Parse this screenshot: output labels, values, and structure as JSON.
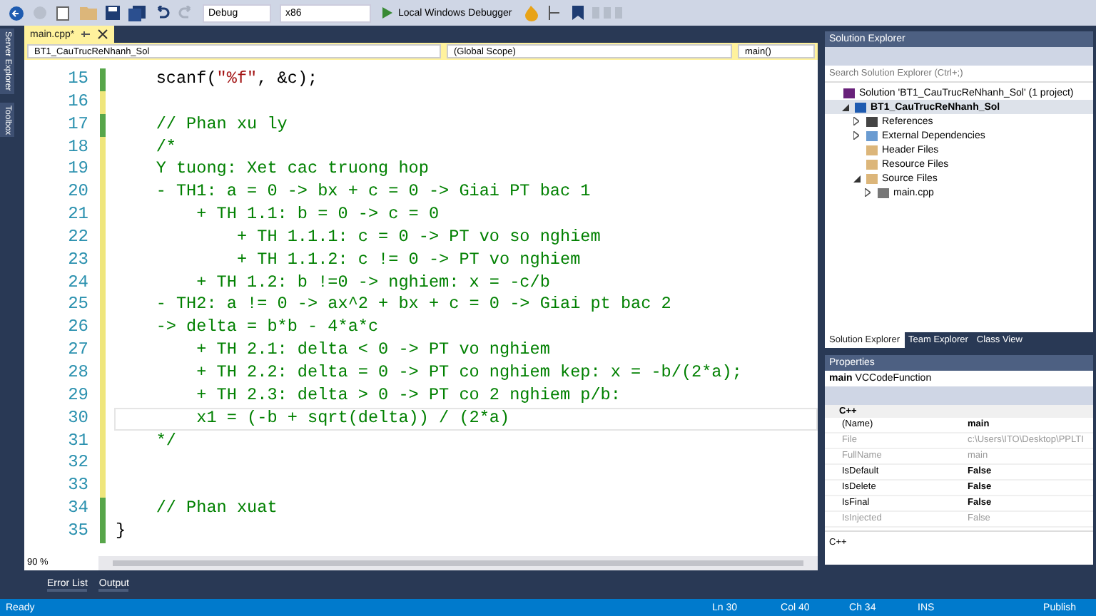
{
  "toolbar": {
    "configuration": "Debug",
    "platform": "x86",
    "debugger": "Local Windows Debugger"
  },
  "side_tabs": [
    "Server Explorer",
    "Toolbox"
  ],
  "document_tabs": [
    {
      "label": "main.cpp*",
      "selected": true
    }
  ],
  "nav_bar": {
    "project": "BT1_CauTrucReNhanh_Sol",
    "scope": "(Global Scope)",
    "member": "main()"
  },
  "editor": {
    "lines": [
      {
        "number": "15",
        "saved": true,
        "selected": false,
        "segments": [
          {
            "kind": "plain",
            "text": "    scanf("
          },
          {
            "kind": "string",
            "text": "\"%f\""
          },
          {
            "kind": "plain",
            "text": ", &c);"
          }
        ]
      },
      {
        "number": "16",
        "saved": false,
        "selected": false
      },
      {
        "number": "17",
        "saved": true,
        "selected": false,
        "segments": [
          {
            "kind": "comment",
            "text": "    // Phan xu ly"
          }
        ]
      },
      {
        "number": "18",
        "saved": false,
        "selected": false,
        "segments": [
          {
            "kind": "comment",
            "text": "    /*"
          }
        ]
      },
      {
        "number": "19",
        "saved": false,
        "selected": false,
        "segments": [
          {
            "kind": "comment",
            "text": "    Y tuong: Xet cac truong hop"
          }
        ]
      },
      {
        "number": "20",
        "saved": false,
        "selected": false,
        "segments": [
          {
            "kind": "comment",
            "text": "    - TH1: a = 0 -> bx + c = 0 -> Giai PT bac 1"
          }
        ]
      },
      {
        "number": "21",
        "saved": false,
        "selected": false,
        "segments": [
          {
            "kind": "comment",
            "text": "        + TH 1.1: b = 0 -> c = 0"
          }
        ]
      },
      {
        "number": "22",
        "saved": false,
        "selected": false,
        "segments": [
          {
            "kind": "comment",
            "text": "            + TH 1.1.1: c = 0 -> PT vo so nghiem"
          }
        ]
      },
      {
        "number": "23",
        "saved": false,
        "selected": false,
        "segments": [
          {
            "kind": "comment",
            "text": "            + TH 1.1.2: c != 0 -> PT vo nghiem"
          }
        ]
      },
      {
        "number": "24",
        "saved": false,
        "selected": false,
        "segments": [
          {
            "kind": "comment",
            "text": "        + TH 1.2: b !=0 -> nghiem: x = -c/b"
          }
        ]
      },
      {
        "number": "25",
        "saved": false,
        "selected": false,
        "segments": [
          {
            "kind": "comment",
            "text": "    - TH2: a != 0 -> ax^2 + bx + c = 0 -> Giai pt bac 2"
          }
        ]
      },
      {
        "number": "26",
        "saved": false,
        "selected": false,
        "segments": [
          {
            "kind": "comment",
            "text": "    -> delta = b*b - 4*a*c"
          }
        ]
      },
      {
        "number": "27",
        "saved": false,
        "selected": false,
        "segments": [
          {
            "kind": "comment",
            "text": "        + TH 2.1: delta < 0 -> PT vo nghiem"
          }
        ]
      },
      {
        "number": "28",
        "saved": false,
        "selected": false,
        "segments": [
          {
            "kind": "comment",
            "text": "        + TH 2.2: delta = 0 -> PT co nghiem kep: x = -b/(2*a);"
          }
        ]
      },
      {
        "number": "29",
        "saved": false,
        "selected": false,
        "segments": [
          {
            "kind": "comment",
            "text": "        + TH 2.3: delta > 0 -> PT co 2 nghiem p/b:"
          }
        ]
      },
      {
        "number": "30",
        "saved": false,
        "selected": true,
        "segments": [
          {
            "kind": "comment",
            "text": "        x1 = (-b + sqrt(delta)) / (2*a)"
          }
        ]
      },
      {
        "number": "31",
        "saved": false,
        "selected": false,
        "segments": [
          {
            "kind": "comment",
            "text": "    */"
          }
        ]
      },
      {
        "number": "32",
        "saved": false,
        "selected": false
      },
      {
        "number": "33",
        "saved": false,
        "selected": false
      },
      {
        "number": "34",
        "saved": true,
        "selected": false,
        "segments": [
          {
            "kind": "comment",
            "text": "    // Phan xuat"
          }
        ]
      },
      {
        "number": "35",
        "saved": true,
        "selected": false,
        "segments": [
          {
            "kind": "plain",
            "text": "}"
          }
        ]
      }
    ],
    "zoom": "90 %"
  },
  "bottom_tabs": [
    {
      "label": "Error List"
    },
    {
      "label": "Output"
    }
  ],
  "solution_explorer": {
    "title": "Solution Explorer",
    "search": {
      "placeholder": "Search Solution Explorer (Ctrl+;)"
    },
    "tree": [
      {
        "label": "Solution 'BT1_CauTrucReNhanh_Sol' (1 project)",
        "kind": "solution",
        "selected": false,
        "children": [
          {
            "label": "BT1_CauTrucReNhanh_Sol",
            "kind": "project",
            "expanded": true,
            "selected": true,
            "children": [
              {
                "label": "References",
                "kind": "references",
                "expanded": false,
                "selected": false
              },
              {
                "label": "External Dependencies",
                "kind": "dependencies",
                "expanded": false,
                "selected": false
              },
              {
                "label": "Header Files",
                "kind": "folder",
                "selected": false
              },
              {
                "label": "Resource Files",
                "kind": "folder",
                "selected": false
              },
              {
                "label": "Source Files",
                "kind": "folder",
                "expanded": true,
                "selected": false,
                "children": [
                  {
                    "label": "main.cpp",
                    "kind": "file",
                    "expanded": false,
                    "selected": false
                  }
                ]
              }
            ]
          }
        ]
      }
    ],
    "tabs": [
      {
        "label": "Solution Explorer",
        "selected": true
      },
      {
        "label": "Team Explorer",
        "selected": false
      },
      {
        "label": "Class View",
        "selected": false
      }
    ]
  },
  "properties": {
    "title": "Properties",
    "object_name": "main",
    "object_type": "VCCodeFunction",
    "category": "C++",
    "rows": [
      {
        "name": "(Name)",
        "value": "main",
        "bold": true,
        "disabled": false
      },
      {
        "name": "File",
        "value": "c:\\Users\\ITO\\Desktop\\PPLTI",
        "bold": false,
        "disabled": true
      },
      {
        "name": "FullName",
        "value": "main",
        "bold": false,
        "disabled": true
      },
      {
        "name": "IsDefault",
        "value": "False",
        "bold": true,
        "disabled": false
      },
      {
        "name": "IsDelete",
        "value": "False",
        "bold": true,
        "disabled": false
      },
      {
        "name": "IsFinal",
        "value": "False",
        "bold": true,
        "disabled": false
      },
      {
        "name": "IsInjected",
        "value": "False",
        "bold": false,
        "disabled": true
      }
    ],
    "description": "C++"
  },
  "status_bar": {
    "state": "Ready",
    "line": "Ln 30",
    "column": "Col 40",
    "character": "Ch 34",
    "mode": "INS",
    "publish": "Publish"
  }
}
